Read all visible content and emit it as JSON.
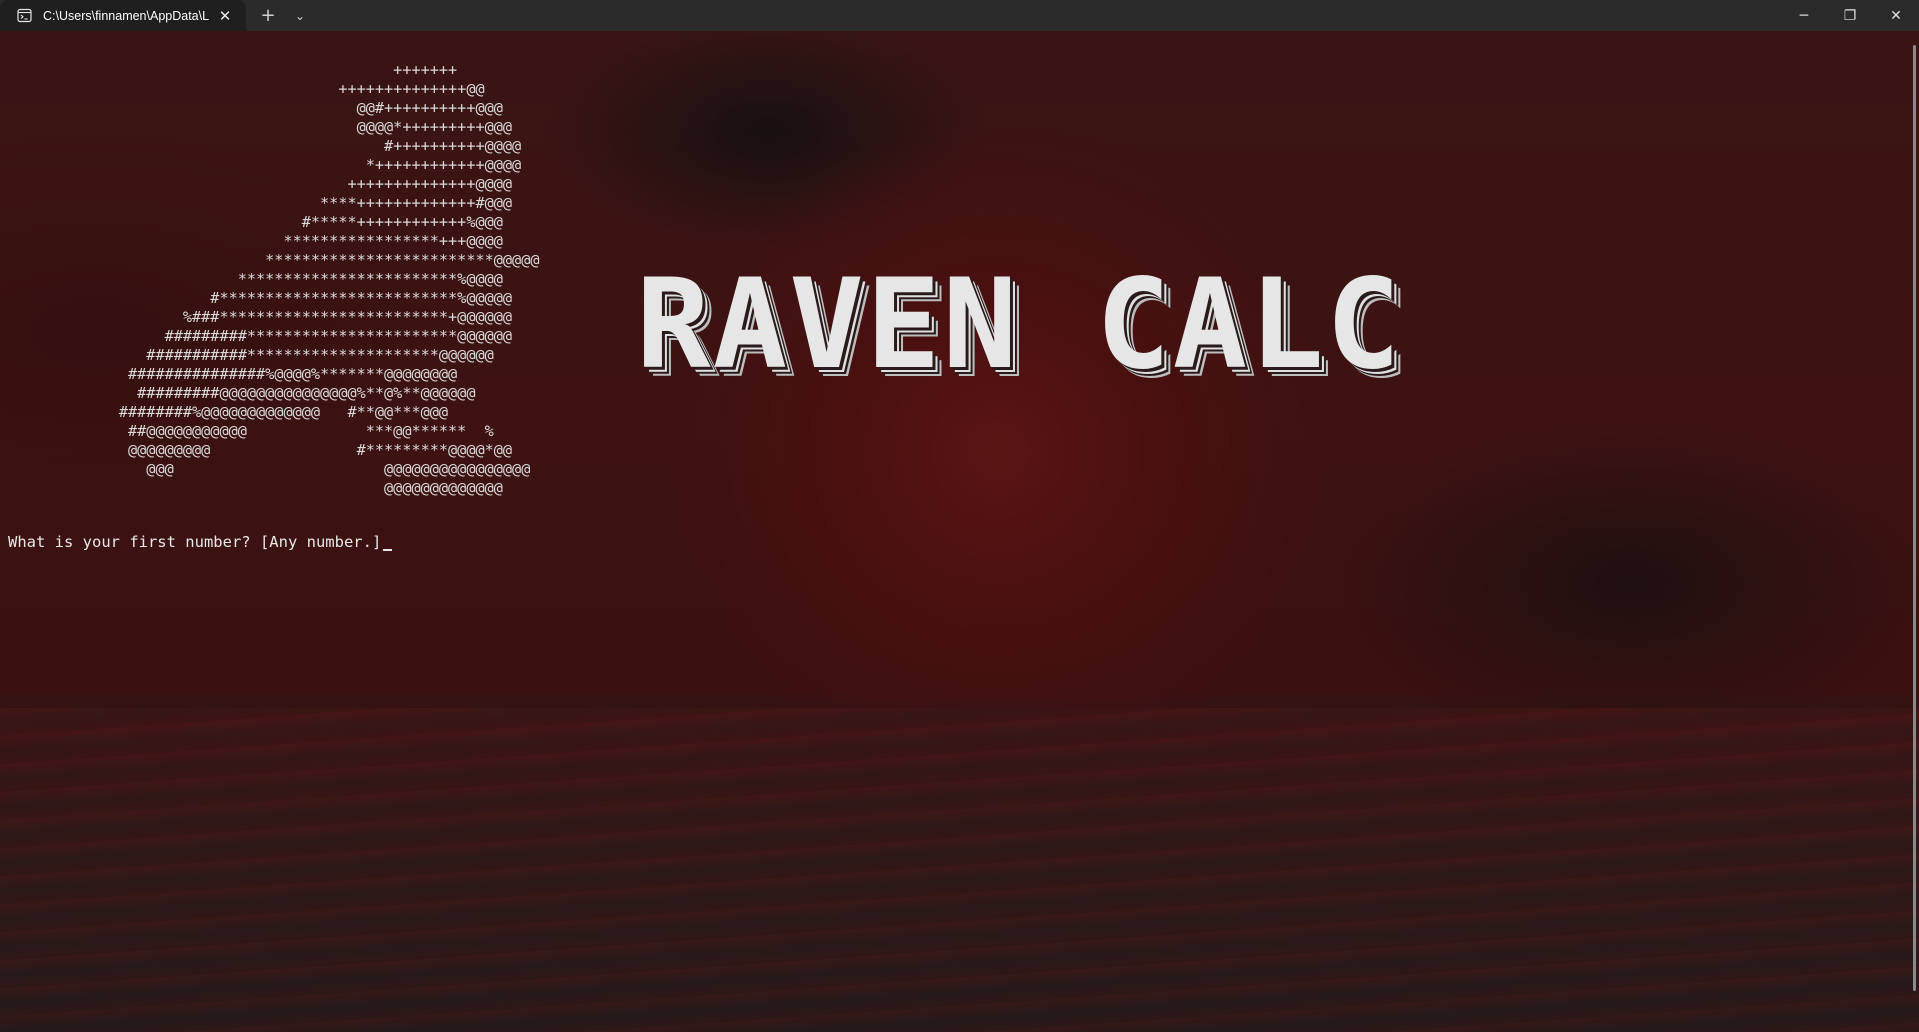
{
  "window": {
    "tab_title": "C:\\Users\\finnamen\\AppData\\L",
    "tab_icon": "terminal-icon",
    "close_tab_glyph": "✕",
    "new_tab_glyph": "+",
    "dropdown_glyph": "⌄",
    "minimize_glyph": "─",
    "restore_glyph": "❐",
    "close_glyph": "✕"
  },
  "terminal": {
    "ascii_art": "                                           +++++++\n                                     ++++++++++++++@@\n                                       @@#++++++++++@@@\n                                       @@@@*+++++++++@@@\n                                          #++++++++++@@@@\n                                        *++++++++++++@@@@\n                                      ++++++++++++++@@@@\n                                   ****+++++++++++++#@@@\n                                 #*****++++++++++++%@@@\n                               *****************+++@@@@\n                             *************************@@@@@\n                          ************************%@@@@\n                       #**************************%@@@@@\n                    %###*************************+@@@@@@\n                  #########***********************@@@@@@\n                ###########*********************@@@@@@\n              ###############%@@@@%*******@@@@@@@@\n               #########@@@@@@@@@@@@@@@%**@%**@@@@@@\n             ########%@@@@@@@@@@@@@   #**@@***@@@\n              ##@@@@@@@@@@@             ***@@******  %\n              @@@@@@@@@                #*********@@@@*@@\n                @@@                       @@@@@@@@@@@@@@@@\n                                          @@@@@@@@@@@@@",
    "banner": "RAVEN CALC",
    "prompt": "What is your first number? [Any number.]"
  },
  "colors": {
    "titlebar": "#2b2b2b",
    "active_tab": "#1f1f1f",
    "text": "#d9d9d9",
    "background_red": "#4a1010"
  }
}
